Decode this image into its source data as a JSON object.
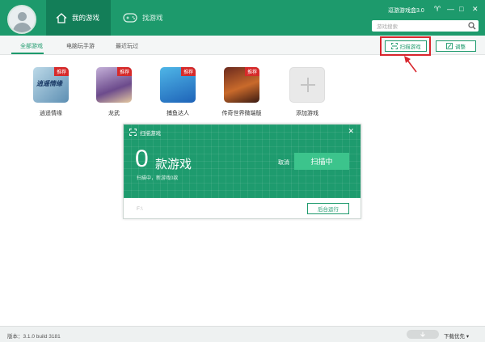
{
  "header": {
    "tabs": [
      {
        "label": "我的游戏",
        "active": true
      },
      {
        "label": "找游戏",
        "active": false
      }
    ],
    "app_title": "逗游游戏盒3.0",
    "window_controls": [
      "♈",
      "—",
      "□",
      "✕"
    ],
    "search": {
      "placeholder": "游戏搜索"
    }
  },
  "subnav": {
    "tabs": [
      {
        "label": "全部游戏",
        "active": true
      },
      {
        "label": "电脑玩手游",
        "active": false
      },
      {
        "label": "最近玩过",
        "active": false
      }
    ],
    "scan_button": "扫描游戏",
    "adjust_button": "调整"
  },
  "games": [
    {
      "name": "逍遥情缘",
      "badge": "推荐",
      "art": "逍遥情缘"
    },
    {
      "name": "龙武",
      "badge": "推荐"
    },
    {
      "name": "捕鱼达人",
      "badge": "推荐"
    },
    {
      "name": "传奇世界微端版",
      "badge": "推荐"
    },
    {
      "name": "添加游戏"
    }
  ],
  "scan_dialog": {
    "title": "扫描游戏",
    "count": "0",
    "unit": "款游戏",
    "status": "扫描中，新游戏0款",
    "cancel": "取消",
    "scanning_button": "扫描中",
    "drive": "F:\\",
    "background_button": "后台运行"
  },
  "statusbar": {
    "version": "版本：3.1.0 build 3181",
    "download_priority": "下载优先"
  },
  "colors": {
    "brand": "#1d9a6c",
    "highlight": "#d8262d",
    "badge": "#d62a2a"
  }
}
